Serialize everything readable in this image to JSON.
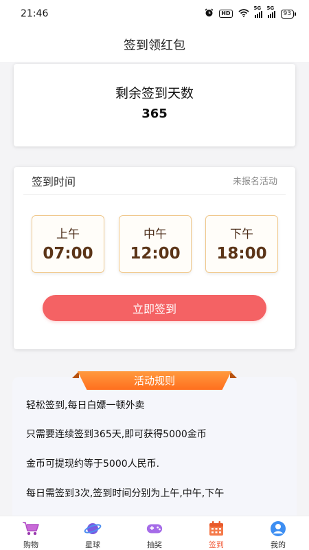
{
  "status_bar": {
    "time": "21:46",
    "hd": "HD",
    "signal_1": "5G",
    "signal_2": "5G",
    "battery": "93"
  },
  "nav": {
    "title": "签到领红包"
  },
  "remaining": {
    "title": "剩余签到天数",
    "count": "365"
  },
  "checkin": {
    "header_title": "签到时间",
    "status": "未报名活动",
    "slots": [
      {
        "label": "上午",
        "time": "07:00"
      },
      {
        "label": "中午",
        "time": "12:00"
      },
      {
        "label": "下午",
        "time": "18:00"
      }
    ],
    "button_label": "立即签到"
  },
  "rules": {
    "title": "活动规则",
    "lines": [
      "轻松签到,每日白嫖一顿外卖",
      "只需要连续签到365天,即可获得5000金币",
      "金币可提现约等于5000人民币.",
      "每日需签到3次,签到时间分别为上午,中午,下午"
    ]
  },
  "tabs": [
    {
      "label": "购物",
      "icon": "shopping-cart-icon"
    },
    {
      "label": "星球",
      "icon": "planet-icon"
    },
    {
      "label": "抽奖",
      "icon": "gamepad-icon"
    },
    {
      "label": "签到",
      "icon": "calendar-icon",
      "active": true
    },
    {
      "label": "我的",
      "icon": "user-icon"
    }
  ],
  "colors": {
    "accent": "#f46264",
    "ribbon": "#ff7a26",
    "active_tab": "#f25c3a",
    "slot_border": "#f0c88c"
  }
}
